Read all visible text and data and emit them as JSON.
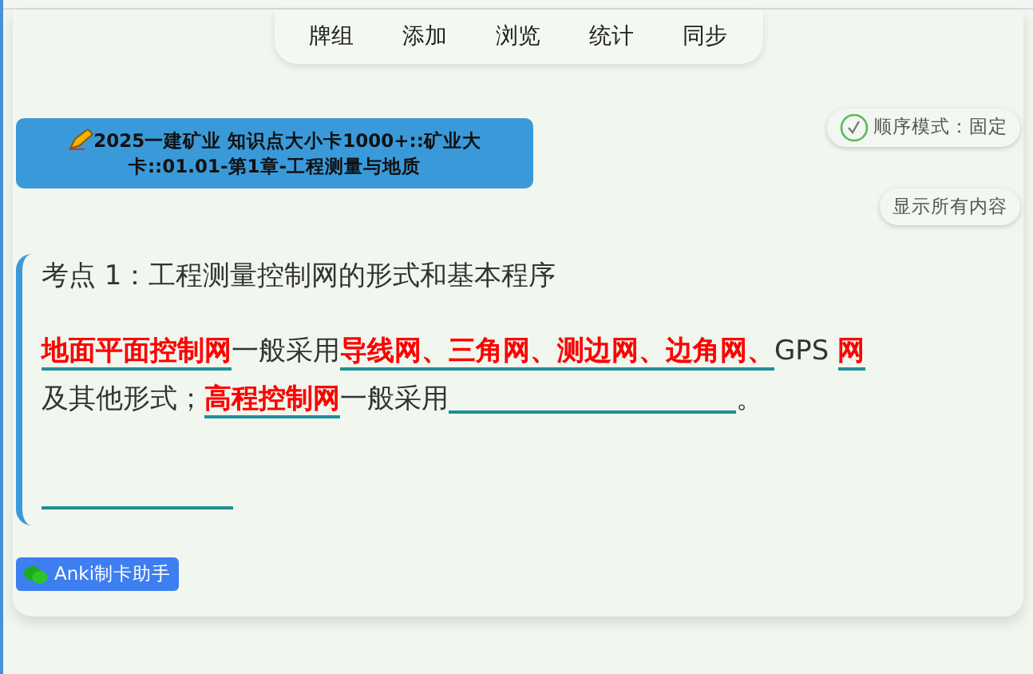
{
  "toolbar": {
    "tabs": [
      {
        "label": "牌组"
      },
      {
        "label": "添加"
      },
      {
        "label": "浏览"
      },
      {
        "label": "统计"
      },
      {
        "label": "同步"
      }
    ]
  },
  "deck_header": {
    "title": "2025一建矿业 知识点大小卡1000+::矿业大卡::01.01-第1章-工程测量与地质"
  },
  "order_mode": {
    "label": "顺序模式：固定",
    "checked": true
  },
  "show_all_button": {
    "label": "显示所有内容"
  },
  "question": {
    "title": "考点 1：工程测量控制网的形式和基本程序",
    "segments": [
      {
        "kind": "answer",
        "text": "地面平面控制网"
      },
      {
        "kind": "text",
        "text": "一般采用"
      },
      {
        "kind": "answer",
        "text": "导线网、三角网、测边网、边角网、"
      },
      {
        "kind": "text",
        "text": "GPS "
      },
      {
        "kind": "answer",
        "text": "网"
      },
      {
        "kind": "text",
        "text": "及其他形式；"
      },
      {
        "kind": "answer",
        "text": "高程控制网"
      },
      {
        "kind": "text",
        "text": "一般采用"
      },
      {
        "kind": "longblank"
      },
      {
        "kind": "text",
        "text": "。"
      },
      {
        "kind": "break"
      },
      {
        "kind": "blank"
      }
    ]
  },
  "footer_badge": {
    "label": "Anki制卡助手"
  }
}
